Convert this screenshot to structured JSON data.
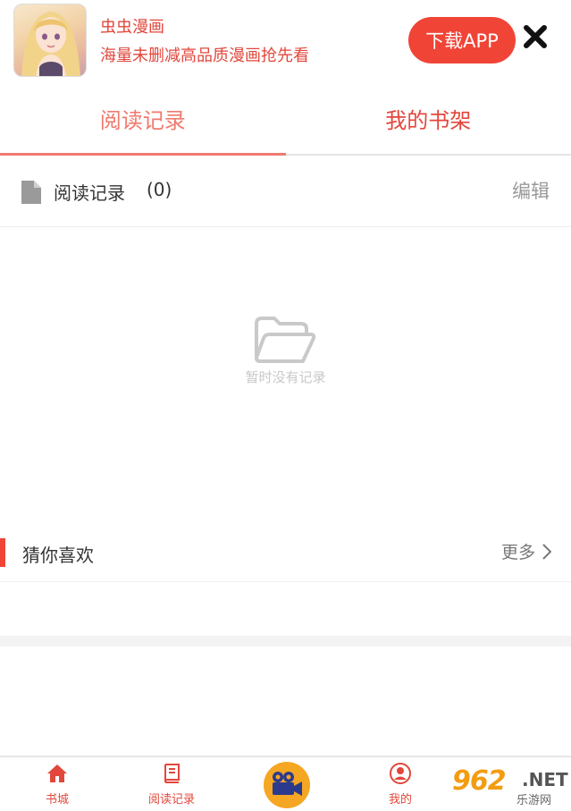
{
  "banner": {
    "app_name": "虫虫漫画",
    "slogan": "海量未删减高品质漫画抢先看",
    "download_label": "下载APP",
    "close_icon": "close-icon"
  },
  "tabs": [
    {
      "label": "阅读记录",
      "active": true
    },
    {
      "label": "我的书架",
      "active": false
    }
  ],
  "history": {
    "title": "阅读记录",
    "count": "(0)",
    "edit_label": "编辑",
    "empty_text": "暂时没有记录"
  },
  "recommend": {
    "title": "猜你喜欢",
    "more_label": "更多"
  },
  "bottom_nav": {
    "items": [
      {
        "label": "书城",
        "icon": "home-icon"
      },
      {
        "label": "阅读记录",
        "icon": "book-icon"
      },
      {
        "label": "",
        "icon": "video-camera-icon"
      },
      {
        "label": "我的",
        "icon": "user-icon"
      }
    ]
  },
  "watermark": {
    "number": "962",
    "domain": ".NET",
    "sub": "乐游网"
  },
  "colors": {
    "accent": "#f04437",
    "tab_active": "#f07a6e",
    "center_button": "#f5a623"
  }
}
